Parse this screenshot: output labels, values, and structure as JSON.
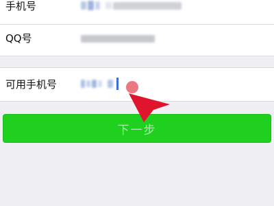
{
  "form": {
    "phone_label": "手机号",
    "qq_label": "QQ号",
    "available_phone_label": "可用手机号"
  },
  "actions": {
    "next_label": "下一步"
  },
  "colors": {
    "page_background": "#efeff4",
    "button_green": "#1fd01f",
    "button_text": "#a7eba7",
    "pointer_red": "#e0142c"
  },
  "icons": {
    "pointer": "red-arrow-pointer-icon"
  }
}
